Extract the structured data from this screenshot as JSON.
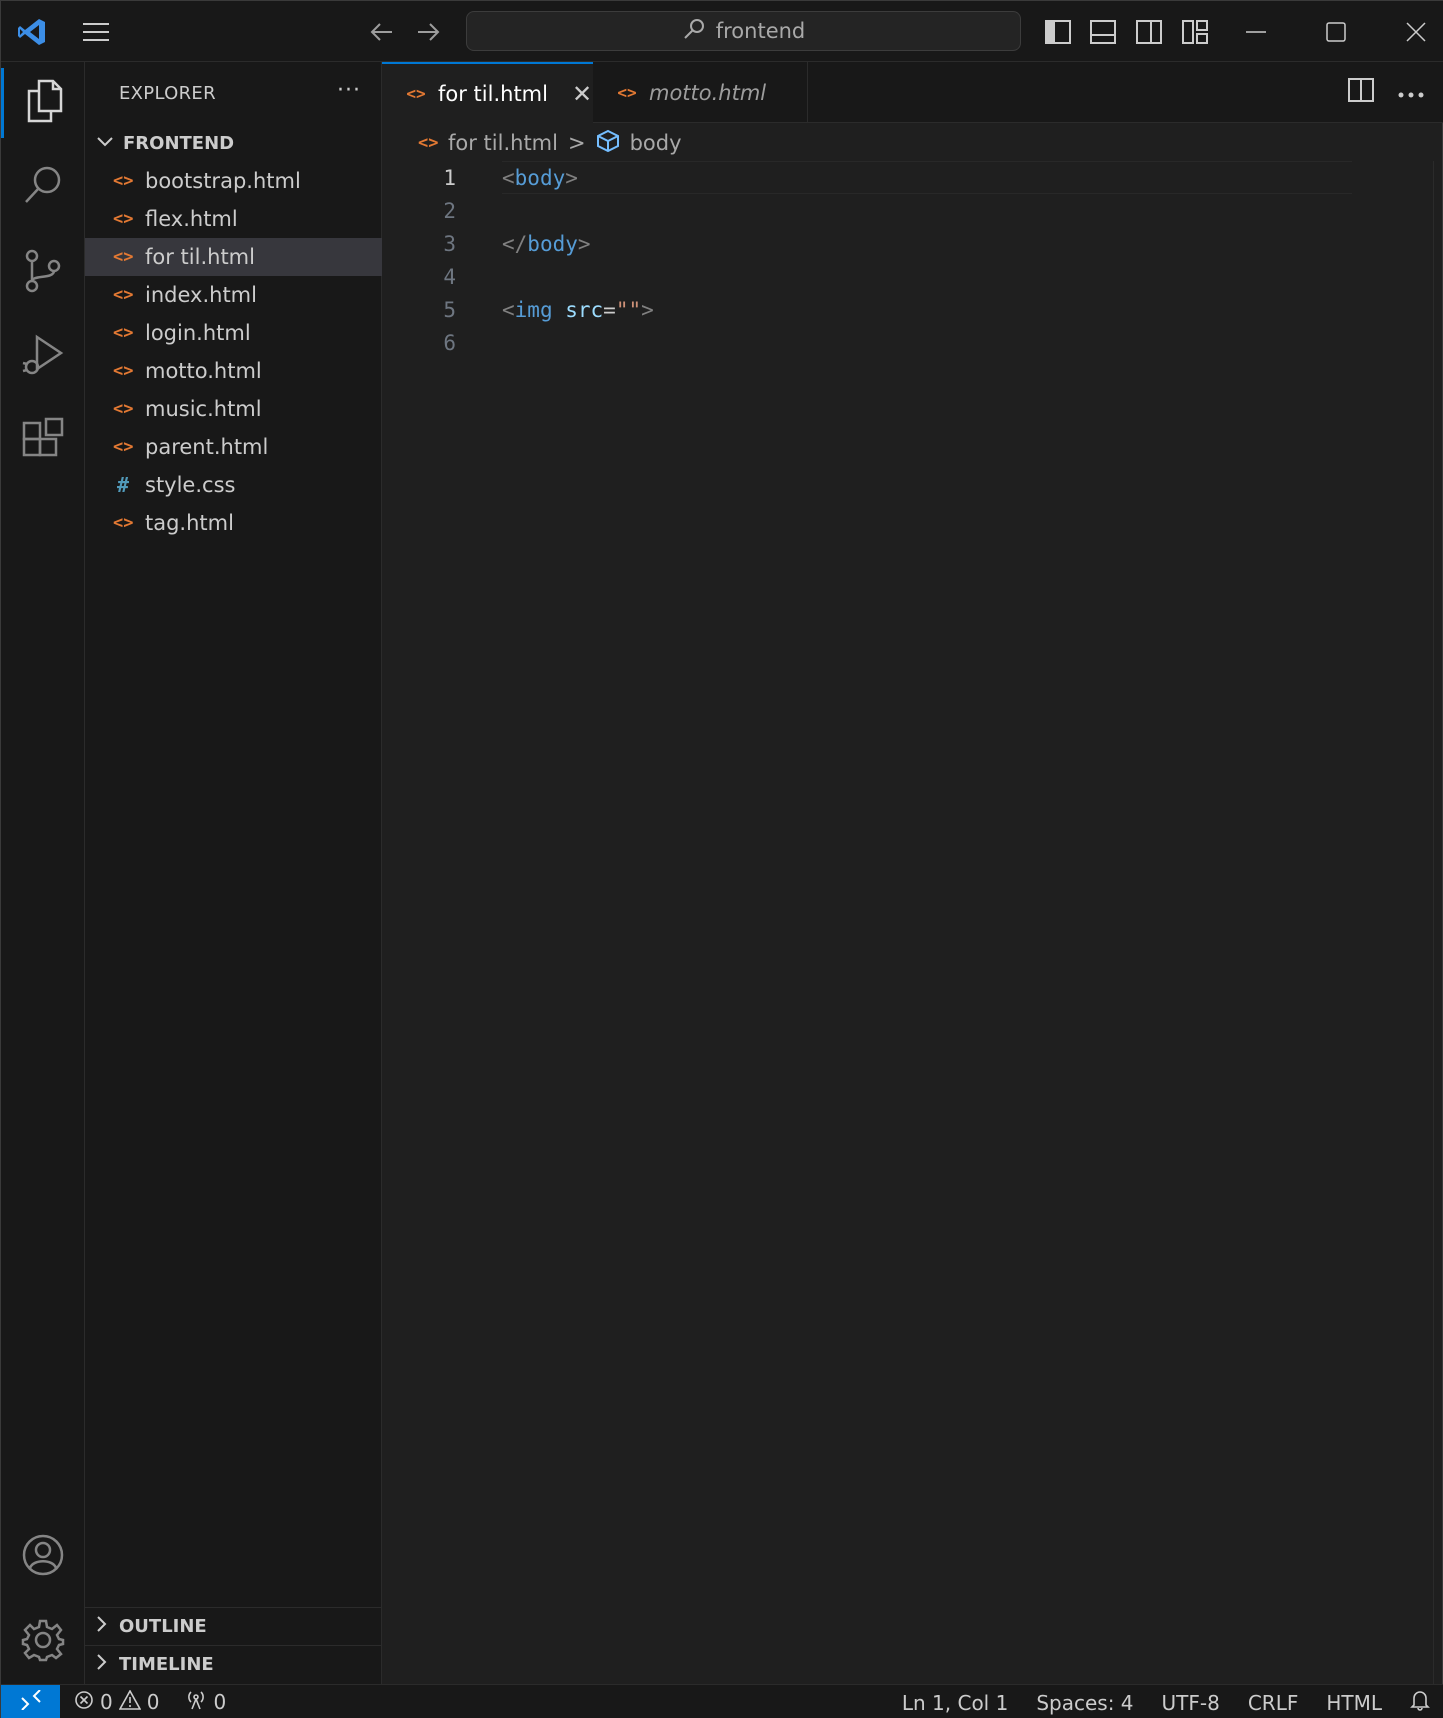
{
  "window": {
    "search_text": "frontend"
  },
  "sidebar": {
    "title": "EXPLORER",
    "more": "···",
    "folder": "FRONTEND",
    "files": [
      {
        "name": "bootstrap.html",
        "icon": "<>"
      },
      {
        "name": "flex.html",
        "icon": "<>"
      },
      {
        "name": "for til.html",
        "icon": "<>",
        "selected": true
      },
      {
        "name": "index.html",
        "icon": "<>"
      },
      {
        "name": "login.html",
        "icon": "<>"
      },
      {
        "name": "motto.html",
        "icon": "<>"
      },
      {
        "name": "music.html",
        "icon": "<>"
      },
      {
        "name": "parent.html",
        "icon": "<>"
      },
      {
        "name": "style.css",
        "icon": "#"
      },
      {
        "name": "tag.html",
        "icon": "<>"
      }
    ],
    "outline": "OUTLINE",
    "timeline": "TIMELINE"
  },
  "tabs": [
    {
      "label": "for til.html",
      "icon": "<>",
      "active": true,
      "close": "✕"
    },
    {
      "label": "motto.html",
      "icon": "<>",
      "active": false
    }
  ],
  "breadcrumb": {
    "file": "for til.html",
    "separator": ">",
    "symbol": "body"
  },
  "editor": {
    "lines": [
      {
        "num": "1",
        "open": "<",
        "tag": "body",
        "close": ">"
      },
      {
        "num": "2"
      },
      {
        "num": "3",
        "open": "</",
        "tag": "body",
        "close": ">"
      },
      {
        "num": "4"
      },
      {
        "num": "5",
        "open": "<",
        "tag": "img",
        "attr": " src",
        "eq": "=",
        "str": "\"\"",
        "close": ">"
      },
      {
        "num": "6"
      }
    ]
  },
  "status": {
    "errors": "0",
    "warnings": "0",
    "ports": "0",
    "position": "Ln 1, Col 1",
    "spaces": "Spaces: 4",
    "encoding": "UTF-8",
    "eol": "CRLF",
    "language": "HTML"
  },
  "colors": {
    "accent": "#0078d4",
    "html_icon": "#e37933",
    "css_icon": "#519aba"
  }
}
